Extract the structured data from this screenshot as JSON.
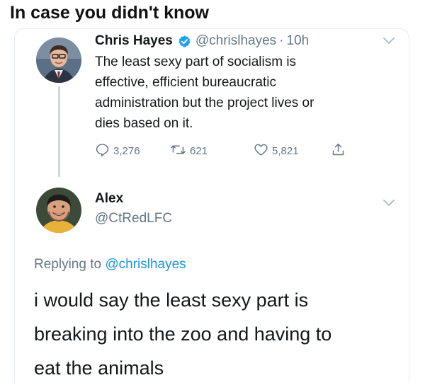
{
  "caption": "In case you didn't know",
  "tweet": {
    "author_name": "Chris Hayes",
    "handle": "@chrislhayes",
    "separator": "·",
    "time": "10h",
    "verified_icon": "verified-badge-icon",
    "body_lines": [
      "The least sexy part of socialism is",
      "effective, efficient bureaucratic",
      "administration but the project lives or",
      "dies based on it."
    ],
    "stats": {
      "replies": "3,276",
      "retweets": "621",
      "likes": "5,821"
    }
  },
  "reply": {
    "author_name": "Alex",
    "handle": "@CtRedLFC",
    "replying_prefix": "Replying to",
    "replying_to": "@chrislhayes",
    "body_lines": [
      "i would say the least sexy part is",
      "breaking into the zoo and having to",
      "eat the animals"
    ]
  },
  "colors": {
    "accent": "#1b95e0",
    "muted": "#657786",
    "text": "#14171a",
    "thread_line": "#cfd9de"
  }
}
